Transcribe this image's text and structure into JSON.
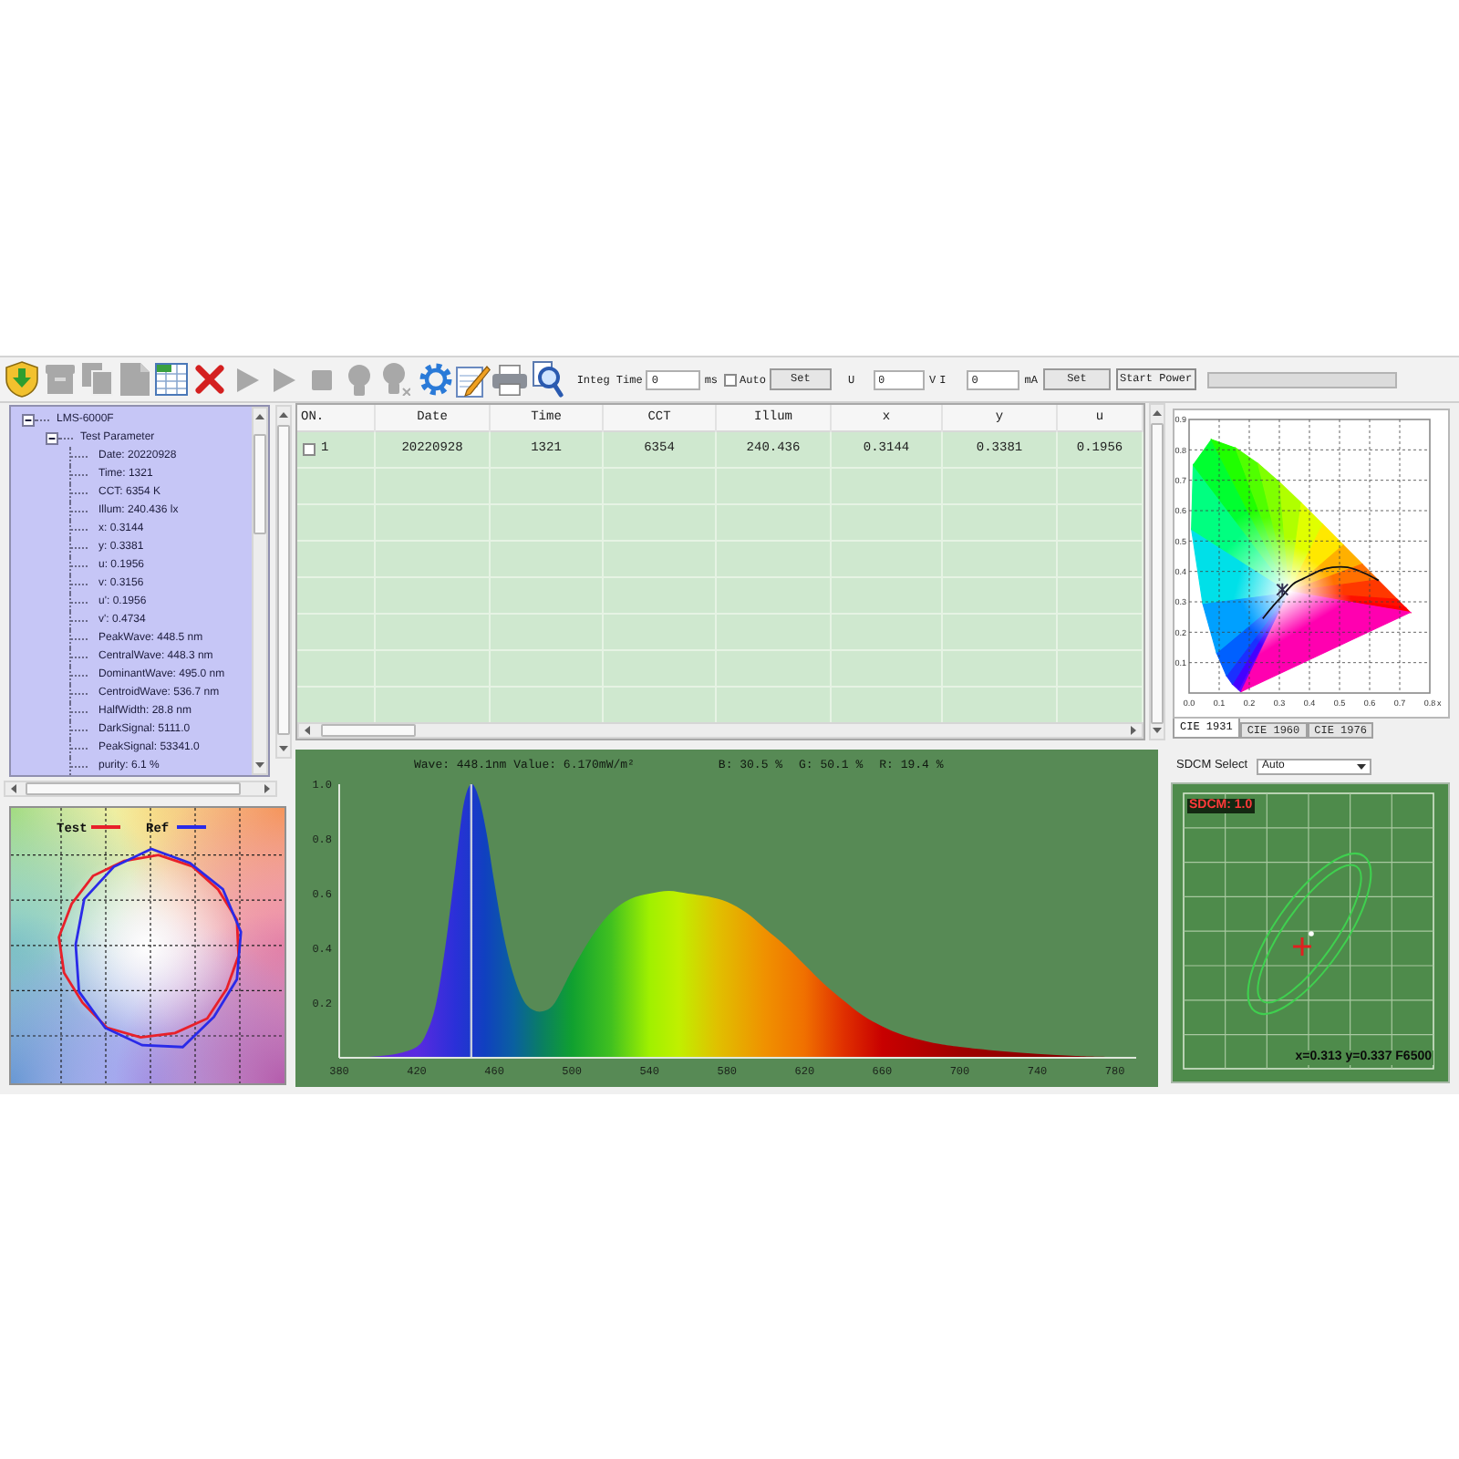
{
  "toolbar": {
    "buttons": [
      {
        "disabled": false
      },
      {
        "disabled": true
      },
      {
        "disabled": true
      },
      {
        "disabled": true
      },
      {
        "disabled": false
      },
      {
        "disabled": false
      },
      {
        "disabled": true
      },
      {
        "disabled": true
      },
      {
        "disabled": true
      },
      {
        "disabled": true
      },
      {
        "disabled": true
      },
      {
        "disabled": false
      },
      {
        "disabled": false
      },
      {
        "disabled": false
      },
      {
        "disabled": false
      }
    ],
    "integ_time": {
      "label": "Integ Time",
      "value": "0",
      "unit": "ms"
    },
    "auto": {
      "label": "Auto",
      "checked": false
    },
    "set_time": "Set",
    "voltage": {
      "label": "U",
      "value": "0",
      "unit": "V"
    },
    "current": {
      "label": "I",
      "value": "0",
      "unit": "mA"
    },
    "set_power": "Set",
    "start_power": "Start Power"
  },
  "tree": [
    {
      "label": "LMS-6000F",
      "expanded": true,
      "children": [
        {
          "label": "Test Parameter",
          "expanded": true,
          "children": [
            {
              "label": "Date: 20220928"
            },
            {
              "label": "Time: 1321"
            },
            {
              "label": "CCT: 6354 K"
            },
            {
              "label": "Illum: 240.436 lx"
            },
            {
              "label": "x: 0.3144"
            },
            {
              "label": "y: 0.3381"
            },
            {
              "label": "u: 0.1956"
            },
            {
              "label": "v: 0.3156"
            },
            {
              "label": "u': 0.1956"
            },
            {
              "label": "v': 0.4734"
            },
            {
              "label": "PeakWave: 448.5 nm"
            },
            {
              "label": "CentralWave: 448.3 nm"
            },
            {
              "label": "DominantWave: 495.0 nm"
            },
            {
              "label": "CentroidWave: 536.7 nm"
            },
            {
              "label": "HalfWidth: 28.8 nm"
            },
            {
              "label": "DarkSignal: 5111.0"
            },
            {
              "label": "PeakSignal: 53341.0"
            },
            {
              "label": "purity: 6.1 %"
            }
          ]
        }
      ]
    }
  ],
  "table": {
    "columns": [
      "ON.",
      "Date",
      "Time",
      "CCT",
      "Illum",
      "x",
      "y",
      "u"
    ],
    "rows": [
      {
        "checked": false,
        "cells": [
          "1",
          "20220928",
          "1321",
          "6354",
          "240.436",
          "0.3144",
          "0.3381",
          "0.1956"
        ]
      }
    ]
  },
  "cie_chart": {
    "chart_data": {
      "type": "scatter",
      "xlabel": "x",
      "x": [
        0.31
      ],
      "series": [
        {
          "values": [
            0.34
          ]
        }
      ],
      "xlim": [
        0,
        0.8
      ],
      "ylim": [
        0,
        0.9
      ],
      "xticks": [
        {
          "value": 0,
          "label": "0.0"
        },
        0.1,
        0.2,
        0.3,
        0.4,
        0.5,
        0.6,
        0.7,
        0.8
      ],
      "yticks": [
        0.1,
        0.2,
        0.3,
        0.4,
        0.5,
        0.6,
        0.7,
        0.8,
        0.9
      ],
      "grid": true
    }
  },
  "cie_tabs": [
    {
      "label": "CIE 1931",
      "selected": true
    },
    {
      "label": "CIE 1960",
      "selected": false
    },
    {
      "label": "CIE 1976",
      "selected": false
    }
  ],
  "sdcm": {
    "select_label": "SDCM Select",
    "select_value": "Auto",
    "value_label": "SDCM: 1.0",
    "coordinates": "x=0.313 y=0.337 F6500"
  },
  "color_rendition": {
    "legend": [
      {
        "label": "Test",
        "color": "#e8202a"
      },
      {
        "label": "Ref",
        "color": "#2a2ae8"
      }
    ]
  },
  "spectrum": {
    "readout": "Wave: 448.1nm Value: 6.170mW/m²",
    "ratios": [
      "B: 30.5 %",
      "G: 50.1 %",
      "R: 19.4 %"
    ],
    "chart_data": {
      "type": "area",
      "x": [
        380,
        390,
        400,
        410,
        420,
        425,
        430,
        435,
        440,
        444,
        448,
        452,
        456,
        460,
        465,
        470,
        475,
        480,
        485,
        490,
        495,
        500,
        510,
        520,
        530,
        540,
        550,
        560,
        570,
        580,
        590,
        600,
        610,
        620,
        630,
        640,
        650,
        660,
        670,
        680,
        690,
        700,
        720,
        740,
        760,
        780
      ],
      "series": [
        {
          "values": [
            0,
            0.002,
            0.006,
            0.015,
            0.04,
            0.09,
            0.2,
            0.42,
            0.7,
            0.92,
            1,
            0.95,
            0.82,
            0.64,
            0.44,
            0.3,
            0.21,
            0.175,
            0.17,
            0.19,
            0.25,
            0.32,
            0.44,
            0.53,
            0.58,
            0.6,
            0.61,
            0.6,
            0.59,
            0.57,
            0.53,
            0.47,
            0.41,
            0.34,
            0.27,
            0.21,
            0.155,
            0.115,
            0.085,
            0.065,
            0.05,
            0.04,
            0.025,
            0.014,
            0.007,
            0.003
          ]
        }
      ],
      "xlim": [
        380,
        791
      ],
      "ylim": [
        0,
        1
      ],
      "xticks": [
        380,
        420,
        460,
        500,
        540,
        580,
        620,
        660,
        700,
        740,
        780
      ],
      "yticks": [
        0.2,
        0.4,
        0.6,
        0.8,
        {
          "value": 1,
          "label": "1.0"
        }
      ],
      "ref_lines": [
        {
          "axis": "x",
          "value": 448.1
        }
      ]
    }
  }
}
